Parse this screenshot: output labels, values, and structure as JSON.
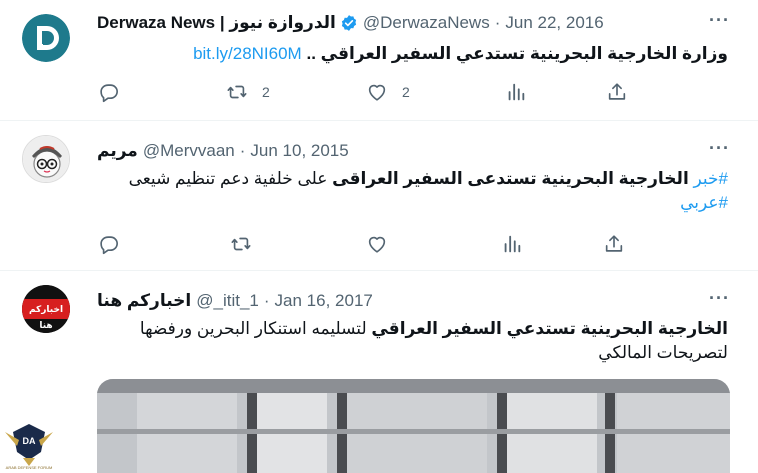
{
  "tweets": [
    {
      "display_name": "Derwaza News | الدروازة نيوز",
      "handle": "@DerwazaNews",
      "separator": "·",
      "date": "Jun 22, 2016",
      "text_bold": "وزارة الخارجية البحرينية تستدعي السفير العراقي ..",
      "text_link": "bit.ly/28NI60M",
      "retweets": "2",
      "likes": "2",
      "verified": true
    },
    {
      "display_name": "مريم",
      "handle": "@Mervvaan",
      "separator": "·",
      "date": "Jun 10, 2015",
      "hashtag_1": "#خبر",
      "text_bold": "الخارجية البحرينية تستدعى السفير العراقى",
      "text_rest": "على خلفية دعم تنظيم شيعى",
      "hashtag_2": "#عربي",
      "retweets": "",
      "likes": ""
    },
    {
      "display_name": "اخباركم هنا",
      "handle": "@_itit_1",
      "separator": "·",
      "date": "Jan 16, 2017",
      "avatar_text": "اخباركم هنا",
      "text_bold": "الخارجية البحرينية تستدعي السفير العراقي",
      "text_rest": "لتسليمه استنكار البحرين ورفضها",
      "text_line2": "لتصريحات المالكي"
    }
  ],
  "more_glyph": "···",
  "watermark": {
    "initials": "DA",
    "caption": "ARAB DEFENSE FORUM"
  },
  "colors": {
    "link": "#1d9bf0",
    "secondary": "#536471",
    "verified": "#1d9bf0",
    "derwaza_logo": "#1e7a8c"
  },
  "icons": [
    "reply-icon",
    "retweet-icon",
    "like-icon",
    "views-icon",
    "share-icon",
    "more-icon",
    "verified-icon"
  ]
}
